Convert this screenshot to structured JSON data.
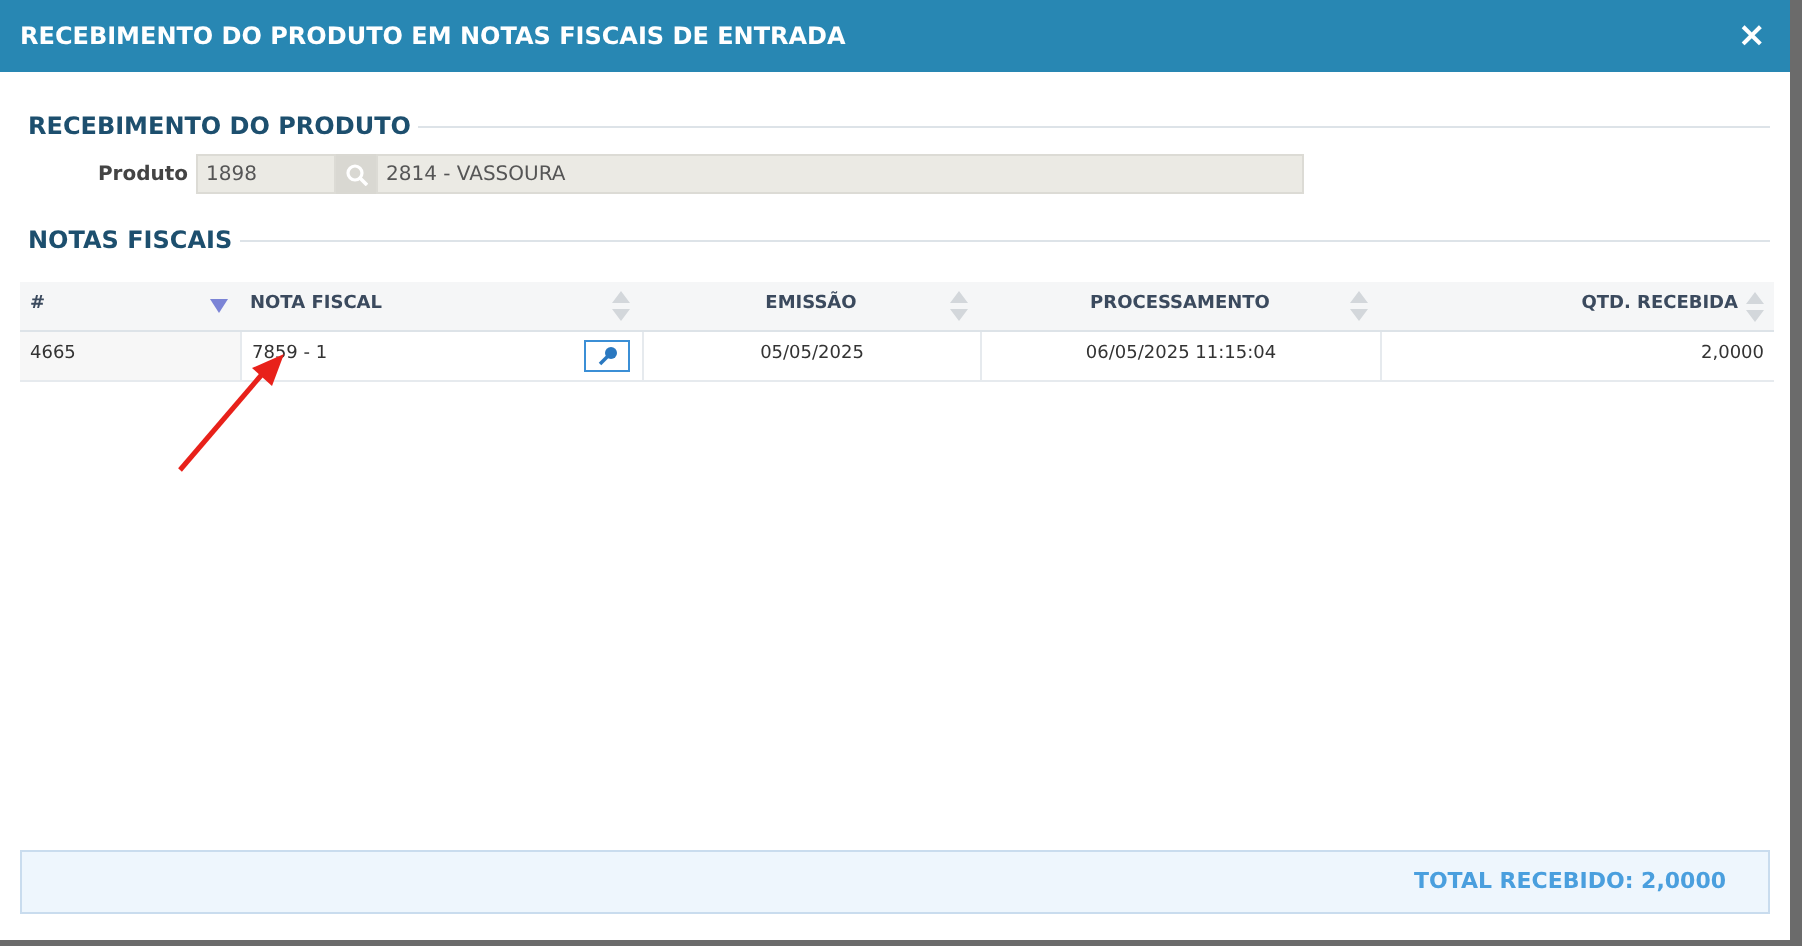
{
  "window": {
    "title": "RECEBIMENTO DO PRODUTO EM NOTAS FISCAIS DE ENTRADA",
    "close": "×"
  },
  "product_section": {
    "title": "RECEBIMENTO DO PRODUTO",
    "label": "Produto",
    "code": "1898",
    "description": "2814 - VASSOURA"
  },
  "invoices_section": {
    "title": "NOTAS FISCAIS"
  },
  "table": {
    "columns": [
      {
        "label": "#",
        "sorted": true
      },
      {
        "label": "NOTA FISCAL",
        "sorted": false
      },
      {
        "label": "EMISSÃO",
        "sorted": false
      },
      {
        "label": "PROCESSAMENTO",
        "sorted": false
      },
      {
        "label": "QTD. RECEBIDA",
        "sorted": false
      }
    ],
    "rows": [
      {
        "cells": [
          "4665",
          "7859 - 1",
          "05/05/2025",
          "06/05/2025 11:15:04",
          "2,0000"
        ]
      }
    ]
  },
  "footer": {
    "total": "TOTAL RECEBIDO: 2,0000"
  }
}
